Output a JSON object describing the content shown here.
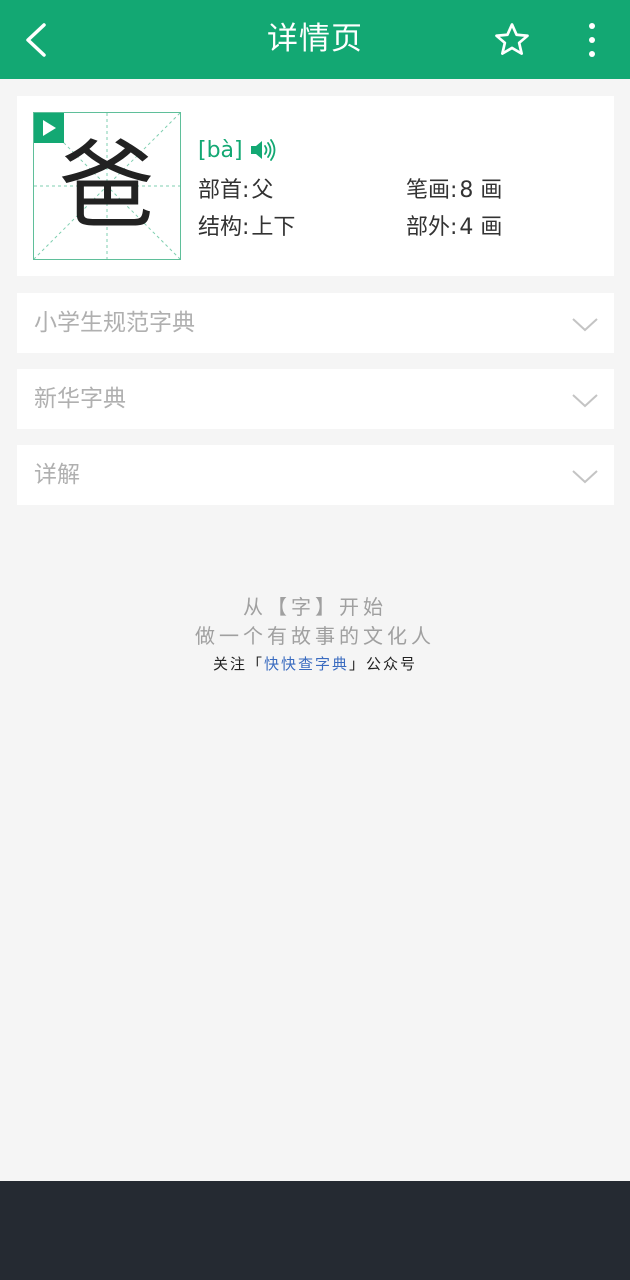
{
  "header": {
    "title": "详情页",
    "back_icon": "chevron-left-icon",
    "star_icon": "star-outline-icon",
    "more_icon": "more-vertical-icon"
  },
  "character": {
    "glyph": "爸",
    "pinyin": "[bà]",
    "radical_label": "部首:",
    "radical_value": "父",
    "strokes_label": "笔画:",
    "strokes_value": "8 画",
    "structure_label": "结构:",
    "structure_value": "上下",
    "extra_strokes_label": "部外:",
    "extra_strokes_value": "4 画"
  },
  "sections": [
    {
      "label": "小学生规范字典"
    },
    {
      "label": "新华字典"
    },
    {
      "label": "详解"
    }
  ],
  "footer": {
    "slogan_line1": "从【字】开始",
    "slogan_line2": "做一个有故事的文化人",
    "follow_prefix": "关注「",
    "follow_brand": "快快查字典",
    "follow_suffix": "」公众号"
  },
  "colors": {
    "brand_green": "#13a873",
    "bottom_bar": "#252a32",
    "brand_link": "#3b6cc0"
  }
}
